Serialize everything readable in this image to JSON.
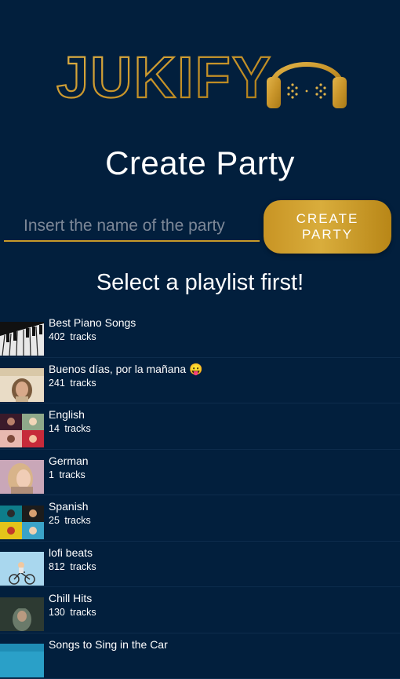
{
  "logo": {
    "text": "JUKIFY",
    "icon": "headphones-icon"
  },
  "header": {
    "title": "Create Party"
  },
  "party_form": {
    "name_placeholder": "Insert the name of the party",
    "name_value": "",
    "create_button": "CREATE PARTY"
  },
  "playlist_section": {
    "title": "Select a playlist first!"
  },
  "playlists": [
    {
      "name": "Best Piano Songs",
      "tracks": "402",
      "tracks_label": "tracks"
    },
    {
      "name": "Buenos días, por la mañana 😛",
      "tracks": "241",
      "tracks_label": "tracks"
    },
    {
      "name": "English",
      "tracks": "14",
      "tracks_label": "tracks"
    },
    {
      "name": "German",
      "tracks": "1",
      "tracks_label": "tracks"
    },
    {
      "name": "Spanish",
      "tracks": "25",
      "tracks_label": "tracks"
    },
    {
      "name": "lofi beats",
      "tracks": "812",
      "tracks_label": "tracks"
    },
    {
      "name": "Chill Hits",
      "tracks": "130",
      "tracks_label": "tracks"
    },
    {
      "name": "Songs to Sing in the Car",
      "tracks": "",
      "tracks_label": ""
    }
  ],
  "colors": {
    "background": "#021f3d",
    "accent_gold": "#d4a233",
    "text": "#ffffff",
    "placeholder": "#7c8797"
  }
}
